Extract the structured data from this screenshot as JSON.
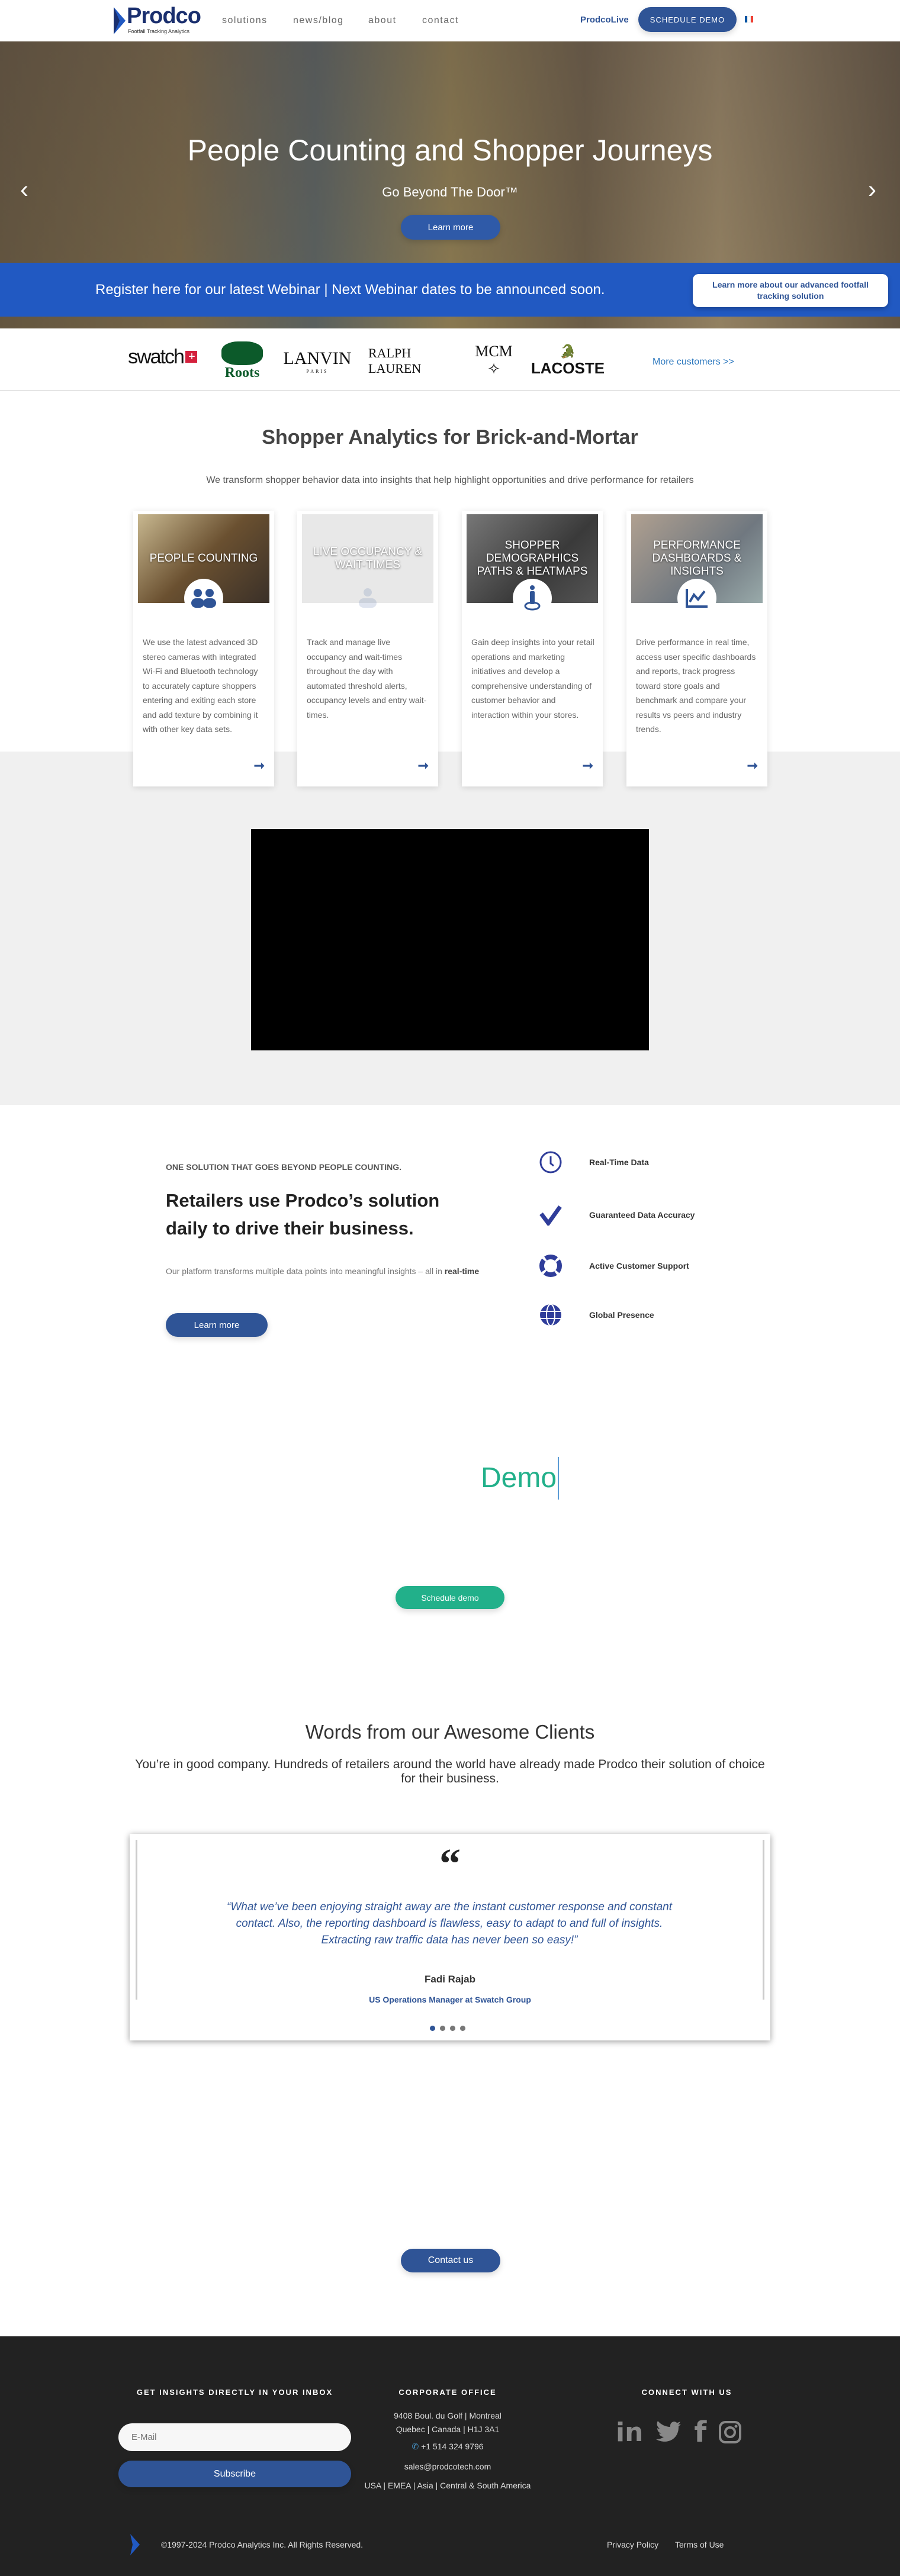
{
  "header": {
    "logo_text": "Prodco",
    "logo_tagline": "Footfall Tracking Analytics",
    "nav": [
      "solutions",
      "news/blog",
      "about",
      "contact"
    ],
    "prodcolive": "ProdcoLive",
    "schedule_demo": "SCHEDULE DEMO",
    "language_flag": "flag-fr-icon"
  },
  "hero": {
    "title": "People Counting and Shopper Journeys",
    "subtitle": "Go Beyond The Door™",
    "cta": "Learn more",
    "prev": "‹",
    "next": "›"
  },
  "banner": {
    "text": "Register here for our latest Webinar | Next Webinar dates to be announced soon.",
    "button": "Learn more about our advanced footfall tracking solution"
  },
  "customers": {
    "logos": [
      "swatch",
      "Roots",
      "LANVIN",
      "PARIS",
      "RALPH LAUREN",
      "MCM",
      "LACOSTE"
    ],
    "more": "More customers >>"
  },
  "analytics": {
    "title": "Shopper Analytics for Brick-and-Mortar",
    "subtitle": "We transform shopper behavior data into insights that help highlight opportunities and drive performance for retailers",
    "cards": [
      {
        "title": "PEOPLE COUNTING",
        "icon": "users-icon",
        "text": "We use the latest advanced 3D stereo cameras with integrated Wi-Fi and Bluetooth technology to accurately capture shoppers entering and exiting each store and add texture by combining it with other key data sets."
      },
      {
        "title": "LIVE OCCUPANCY & WAIT-TIMES",
        "icon": "group-icon",
        "text": "Track and manage live occupancy and wait-times throughout the day with automated threshold alerts, occupancy levels and entry wait-times."
      },
      {
        "title": "SHOPPER DEMOGRAPHICS PATHS & HEATMAPS",
        "icon": "person-location-icon",
        "text": "Gain deep insights into your retail operations and marketing initiatives and develop a comprehensive understanding of customer behavior and interaction within your stores."
      },
      {
        "title": "PERFORMANCE DASHBOARDS & INSIGHTS",
        "icon": "chart-line-icon",
        "text": "Drive performance in real time, access user specific dashboards and reports, track progress toward store goals and benchmark and compare your results vs peers and industry trends."
      }
    ]
  },
  "solution": {
    "eyebrow": "ONE SOLUTION THAT GOES BEYOND PEOPLE COUNTING.",
    "title": "Retailers use Prodco’s solution daily to drive their business.",
    "para": "Our platform transforms multiple data points into meaningful insights – all in ",
    "para_bold": "real-time",
    "cta": "Learn more",
    "features": [
      {
        "label": "Real-Time Data",
        "icon": "clock-icon"
      },
      {
        "label": "Guaranteed Data Accuracy",
        "icon": "check-icon"
      },
      {
        "label": "Active Customer Support",
        "icon": "lifebuoy-icon"
      },
      {
        "label": "Global Presence",
        "icon": "globe-icon"
      }
    ]
  },
  "demo": {
    "typed": "Demo",
    "cta": "Schedule demo",
    "accent": "#22b08a"
  },
  "testimonials": {
    "title": "Words from our Awesome Clients",
    "subtitle": "You’re in good company. Hundreds of retailers around the world have already made Prodco their solution of choice for their business.",
    "quote": "“What we’ve been enjoying straight away are the instant customer response and constant contact. Also, the reporting dashboard is flawless, easy to adapt to and full of insights. Extracting raw traffic data has never been so easy!”",
    "name": "Fadi Rajab",
    "role": "US Operations Manager at Swatch Group",
    "slides": 4,
    "active_slide": 1
  },
  "contact": {
    "cta": "Contact us"
  },
  "footer": {
    "newsletter_heading": "GET INSIGHTS DIRECTLY IN YOUR INBOX",
    "email_placeholder": "E-Mail",
    "subscribe": "Subscribe",
    "office_heading": "CORPORATE OFFICE",
    "address1": "9408 Boul. du Golf | Montreal",
    "address2": "Quebec | Canada | H1J 3A1",
    "phone": "+1 514 324 9796",
    "email": "sales@prodcotech.com",
    "regions": "USA | EMEA | Asia | Central & South America",
    "connect_heading": "CONNECT WITH US",
    "social": [
      "linkedin-icon",
      "twitter-icon",
      "facebook-icon",
      "instagram-icon"
    ],
    "copyright": "©1997-2024 Prodco Analytics Inc. All Rights Reserved.",
    "privacy": "Privacy Policy",
    "terms": "Terms of Use"
  },
  "colors": {
    "brand": "#2f5496",
    "banner": "#2159c2",
    "footer": "#222222"
  }
}
